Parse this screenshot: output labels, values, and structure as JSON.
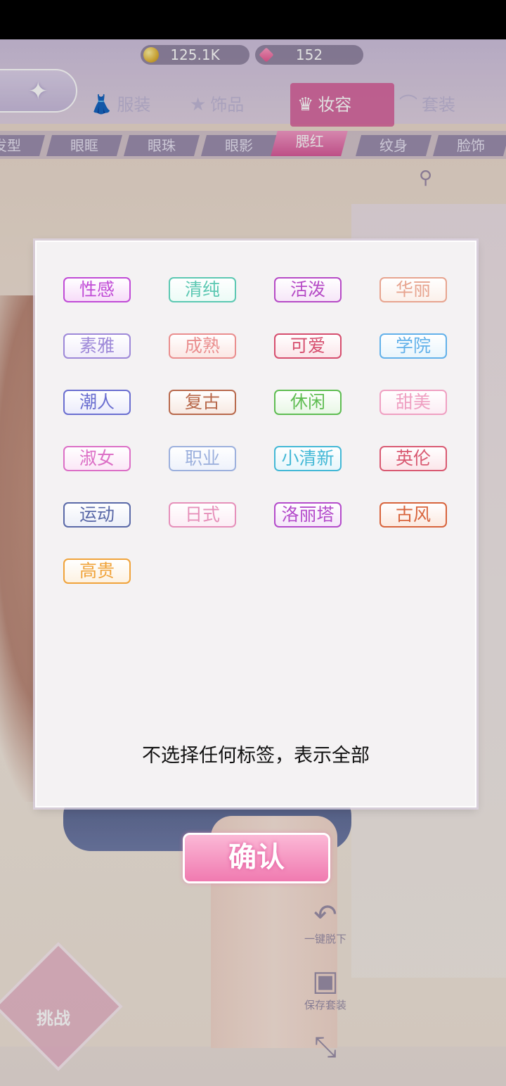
{
  "currency": {
    "gold": "125.1K",
    "gems": "152"
  },
  "categories": [
    {
      "label": "服装",
      "icon": "dress-icon"
    },
    {
      "label": "饰品",
      "icon": "stars-icon"
    },
    {
      "label": "妆容",
      "icon": "cosmetics-icon",
      "active": true
    },
    {
      "label": "套装",
      "icon": "hat-icon"
    }
  ],
  "subtabs": [
    "发型",
    "眼眶",
    "眼珠",
    "眼影",
    "腮红",
    "纹身",
    "脸饰"
  ],
  "active_subtab": "腮红",
  "tags": [
    {
      "label": "性感",
      "color": "#c04bd6",
      "bg": "#f7dcf9"
    },
    {
      "label": "清纯",
      "color": "#5cc8b2",
      "bg": "#ecfbf6"
    },
    {
      "label": "活泼",
      "color": "#b64bc6",
      "bg": "#f6e6f8"
    },
    {
      "label": "华丽",
      "color": "#e7a48f",
      "bg": "#fbf0ea"
    },
    {
      "label": "素雅",
      "color": "#9d88d8",
      "bg": "#f1edfa"
    },
    {
      "label": "成熟",
      "color": "#ea8e8e",
      "bg": "#fbe7e4"
    },
    {
      "label": "可爱",
      "color": "#d64e6e",
      "bg": "#fbe5e9"
    },
    {
      "label": "学院",
      "color": "#62b1ea",
      "bg": "#e9f5fc"
    },
    {
      "label": "潮人",
      "color": "#6a6ed0",
      "bg": "#ebecfb"
    },
    {
      "label": "复古",
      "color": "#b8694c",
      "bg": "#f7e9e2"
    },
    {
      "label": "休闲",
      "color": "#5fbd52",
      "bg": "#e8f7e5"
    },
    {
      "label": "甜美",
      "color": "#efa0c2",
      "bg": "#fcedf4"
    },
    {
      "label": "淑女",
      "color": "#dc6fc6",
      "bg": "#fbe7f7"
    },
    {
      "label": "职业",
      "color": "#9cb0dd",
      "bg": "#eef2fb"
    },
    {
      "label": "小清新",
      "color": "#43b8d6",
      "bg": "#e6f6fb"
    },
    {
      "label": "英伦",
      "color": "#d95a72",
      "bg": "#fbe6ea"
    },
    {
      "label": "运动",
      "color": "#5a69a8",
      "bg": "#eceff8"
    },
    {
      "label": "日式",
      "color": "#e690ba",
      "bg": "#fcedf5"
    },
    {
      "label": "洛丽塔",
      "color": "#b44ccb",
      "bg": "#f5e6f9"
    },
    {
      "label": "古风",
      "color": "#d8643c",
      "bg": "#fbe9e0"
    },
    {
      "label": "高贵",
      "color": "#f0a33a",
      "bg": "#fdf2e2"
    }
  ],
  "hint": "不选择任何标签，表示全部",
  "confirm_label": "确认",
  "tools": {
    "undress_label": "一键脱下",
    "save_label": "保存套装"
  },
  "challenge_label": "挑战"
}
